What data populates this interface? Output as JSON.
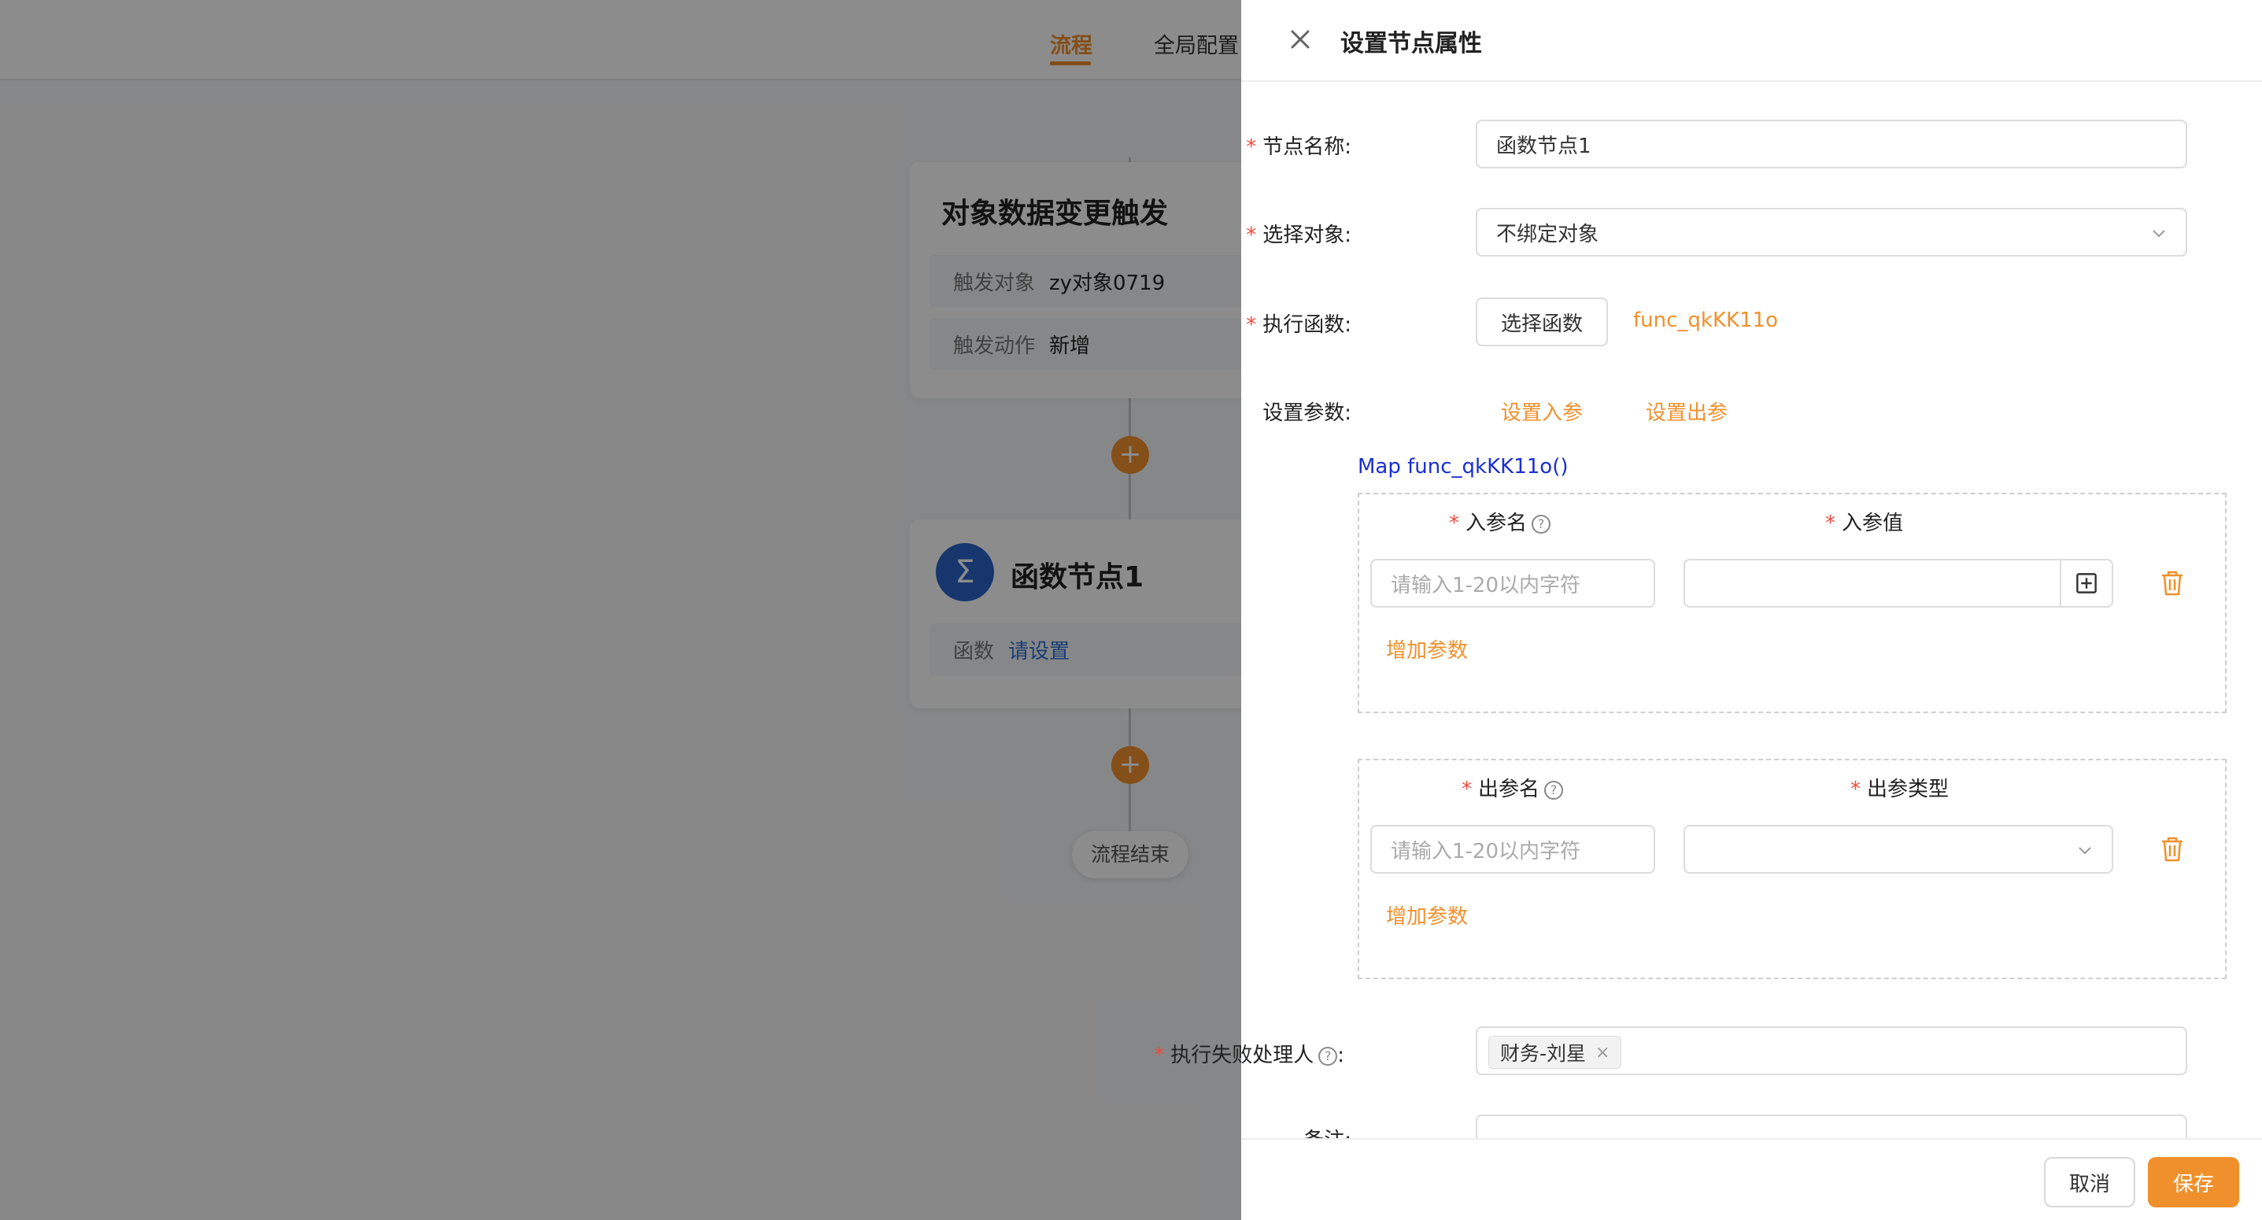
{
  "canvas": {
    "tabs": [
      {
        "label": "流程",
        "active": true
      },
      {
        "label": "全局配置",
        "active": false
      }
    ],
    "trigger_card": {
      "title": "对象数据变更触发",
      "rows": [
        {
          "key": "触发对象",
          "value": "zy对象0719"
        },
        {
          "key": "触发动作",
          "value": "新增"
        }
      ]
    },
    "function_card": {
      "title": "函数节点1",
      "row_key": "函数",
      "row_link": "请设置"
    },
    "end_label": "流程结束"
  },
  "drawer": {
    "title": "设置节点属性",
    "node_name": {
      "label": "节点名称:",
      "value": "函数节点1"
    },
    "select_object": {
      "label": "选择对象:",
      "value": "不绑定对象"
    },
    "exec_function": {
      "label": "执行函数:",
      "button": "选择函数",
      "function_name": "func_qkKK11o"
    },
    "set_params": {
      "label": "设置参数:",
      "input_link": "设置入参",
      "output_link": "设置出参"
    },
    "signature": "Map func_qkKK11o()",
    "input_params": {
      "name_header": "入参名",
      "value_header": "入参值",
      "name_placeholder": "请输入1-20以内字符",
      "add_label": "增加参数"
    },
    "output_params": {
      "name_header": "出参名",
      "type_header": "出参类型",
      "name_placeholder": "请输入1-20以内字符",
      "add_label": "增加参数"
    },
    "failure_handler": {
      "label": "执行失败处理人",
      "tag": "财务-刘星"
    },
    "remark": {
      "label": "备注:"
    },
    "footer": {
      "cancel": "取消",
      "save": "保存"
    }
  },
  "colors": {
    "accent": "#f0902c",
    "required": "#f04a3c",
    "link_blue": "#2f6fd6",
    "signature_blue": "#1a2fd0"
  }
}
